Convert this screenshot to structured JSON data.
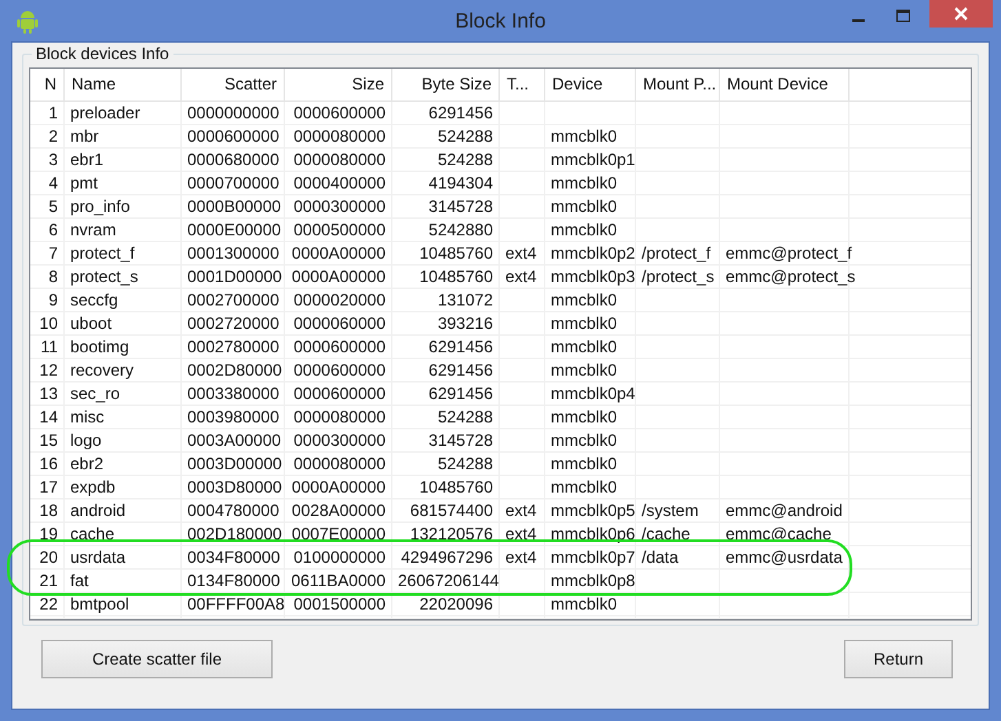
{
  "window": {
    "title": "Block Info"
  },
  "group": {
    "title": "Block devices Info"
  },
  "table": {
    "columns": [
      "N",
      "Name",
      "Scatter",
      "Size",
      "Byte Size",
      "T...",
      "Device",
      "Mount P...",
      "Mount Device"
    ],
    "rows": [
      {
        "n": "1",
        "name": "preloader",
        "scatter": "0000000000",
        "size": "0000600000",
        "byte_size": "6291456",
        "circled": false
      },
      {
        "n": "2",
        "name": "mbr",
        "scatter": "0000600000",
        "size": "0000080000",
        "byte_size": "524288",
        "device": "mmcblk0",
        "circled": false
      },
      {
        "n": "3",
        "name": "ebr1",
        "scatter": "0000680000",
        "size": "0000080000",
        "byte_size": "524288",
        "device": "mmcblk0p1",
        "circled": false
      },
      {
        "n": "4",
        "name": "pmt",
        "scatter": "0000700000",
        "size": "0000400000",
        "byte_size": "4194304",
        "device": "mmcblk0",
        "circled": false
      },
      {
        "n": "5",
        "name": "pro_info",
        "scatter": "0000B00000",
        "size": "0000300000",
        "byte_size": "3145728",
        "device": "mmcblk0",
        "circled": false
      },
      {
        "n": "6",
        "name": "nvram",
        "scatter": "0000E00000",
        "size": "0000500000",
        "byte_size": "5242880",
        "device": "mmcblk0",
        "circled": false
      },
      {
        "n": "7",
        "name": "protect_f",
        "scatter": "0001300000",
        "size": "0000A00000",
        "byte_size": "10485760",
        "type": "ext4",
        "device": "mmcblk0p2",
        "mount_point": "/protect_f",
        "mount_device": "emmc@protect_f",
        "circled": false
      },
      {
        "n": "8",
        "name": "protect_s",
        "scatter": "0001D00000",
        "size": "0000A00000",
        "byte_size": "10485760",
        "type": "ext4",
        "device": "mmcblk0p3",
        "mount_point": "/protect_s",
        "mount_device": "emmc@protect_s",
        "circled": false
      },
      {
        "n": "9",
        "name": "seccfg",
        "scatter": "0002700000",
        "size": "0000020000",
        "byte_size": "131072",
        "device": "mmcblk0",
        "circled": false
      },
      {
        "n": "10",
        "name": "uboot",
        "scatter": "0002720000",
        "size": "0000060000",
        "byte_size": "393216",
        "device": "mmcblk0",
        "circled": false
      },
      {
        "n": "11",
        "name": "bootimg",
        "scatter": "0002780000",
        "size": "0000600000",
        "byte_size": "6291456",
        "device": "mmcblk0",
        "circled": false
      },
      {
        "n": "12",
        "name": "recovery",
        "scatter": "0002D80000",
        "size": "0000600000",
        "byte_size": "6291456",
        "device": "mmcblk0",
        "circled": false
      },
      {
        "n": "13",
        "name": "sec_ro",
        "scatter": "0003380000",
        "size": "0000600000",
        "byte_size": "6291456",
        "device": "mmcblk0p4",
        "circled": false
      },
      {
        "n": "14",
        "name": "misc",
        "scatter": "0003980000",
        "size": "0000080000",
        "byte_size": "524288",
        "device": "mmcblk0",
        "circled": false
      },
      {
        "n": "15",
        "name": "logo",
        "scatter": "0003A00000",
        "size": "0000300000",
        "byte_size": "3145728",
        "device": "mmcblk0",
        "circled": false
      },
      {
        "n": "16",
        "name": "ebr2",
        "scatter": "0003D00000",
        "size": "0000080000",
        "byte_size": "524288",
        "device": "mmcblk0",
        "circled": false
      },
      {
        "n": "17",
        "name": "expdb",
        "scatter": "0003D80000",
        "size": "0000A00000",
        "byte_size": "10485760",
        "device": "mmcblk0",
        "circled": false
      },
      {
        "n": "18",
        "name": "android",
        "scatter": "0004780000",
        "size": "0028A00000",
        "byte_size": "681574400",
        "type": "ext4",
        "device": "mmcblk0p5",
        "mount_point": "/system",
        "mount_device": "emmc@android",
        "circled": false
      },
      {
        "n": "19",
        "name": "cache",
        "scatter": "002D180000",
        "size": "0007E00000",
        "byte_size": "132120576",
        "type": "ext4",
        "device": "mmcblk0p6",
        "mount_point": "/cache",
        "mount_device": "emmc@cache",
        "circled": false
      },
      {
        "n": "20",
        "name": "usrdata",
        "scatter": "0034F80000",
        "size": "0100000000",
        "byte_size": "4294967296",
        "type": "ext4",
        "device": "mmcblk0p7",
        "mount_point": "/data",
        "mount_device": "emmc@usrdata",
        "circled": true
      },
      {
        "n": "21",
        "name": "fat",
        "scatter": "0134F80000",
        "size": "0611BA0000",
        "byte_size": "26067206144",
        "device": "mmcblk0p8",
        "circled": true
      },
      {
        "n": "22",
        "name": "bmtpool",
        "scatter": "00FFFF00A8",
        "size": "0001500000",
        "byte_size": "22020096",
        "device": "mmcblk0",
        "circled": false
      }
    ]
  },
  "buttons": [
    {
      "label": "Create scatter file",
      "kind": "left"
    },
    {
      "label": "Return",
      "kind": "right"
    }
  ]
}
